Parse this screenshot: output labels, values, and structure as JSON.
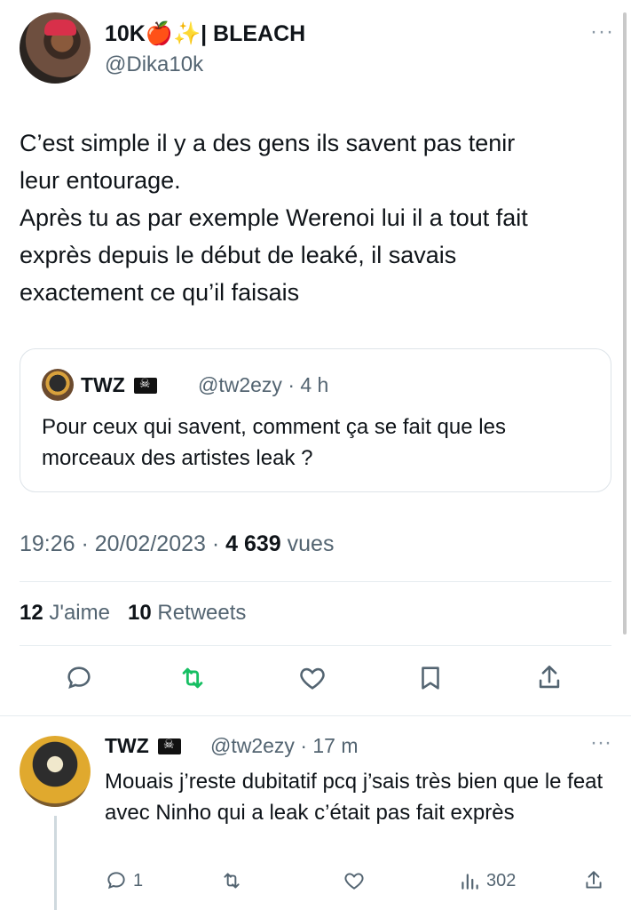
{
  "tweet": {
    "author_name": "10K🍎✨| BLEACH",
    "author_handle": "@Dika10k",
    "text_lines": [
      "C’est simple il y a des gens ils savent pas tenir",
      "leur entourage.",
      "Après tu as par exemple Werenoi lui il a tout fait",
      "exprès depuis le début de leaké, il savais",
      "exactement ce qu’il faisais"
    ],
    "time": "19:26 · 20/02/2023 · ",
    "views_count": "4 639",
    "views_label": " vues",
    "likes_count": "12",
    "likes_label": " J'aime",
    "retweets_count": "10",
    "retweets_label": " Retweets"
  },
  "quoted": {
    "name": "TWZ",
    "meta": "@tw2ezy · 4 h",
    "text": "Pour ceux qui savent, comment ça se fait que les morceaux des artistes leak ?"
  },
  "reply": {
    "name": "TWZ",
    "meta": "@tw2ezy · 17 m",
    "text": "Mouais j’reste dubitatif pcq j’sais très bien que le feat avec Ninho qui a leak c’était pas fait exprès",
    "reply_count": "1",
    "views_count": "302"
  },
  "more_label": "···",
  "colors": {
    "retweet_green": "#17bf63",
    "icon_dark": "#536471",
    "accent": "#1d9bf0"
  }
}
